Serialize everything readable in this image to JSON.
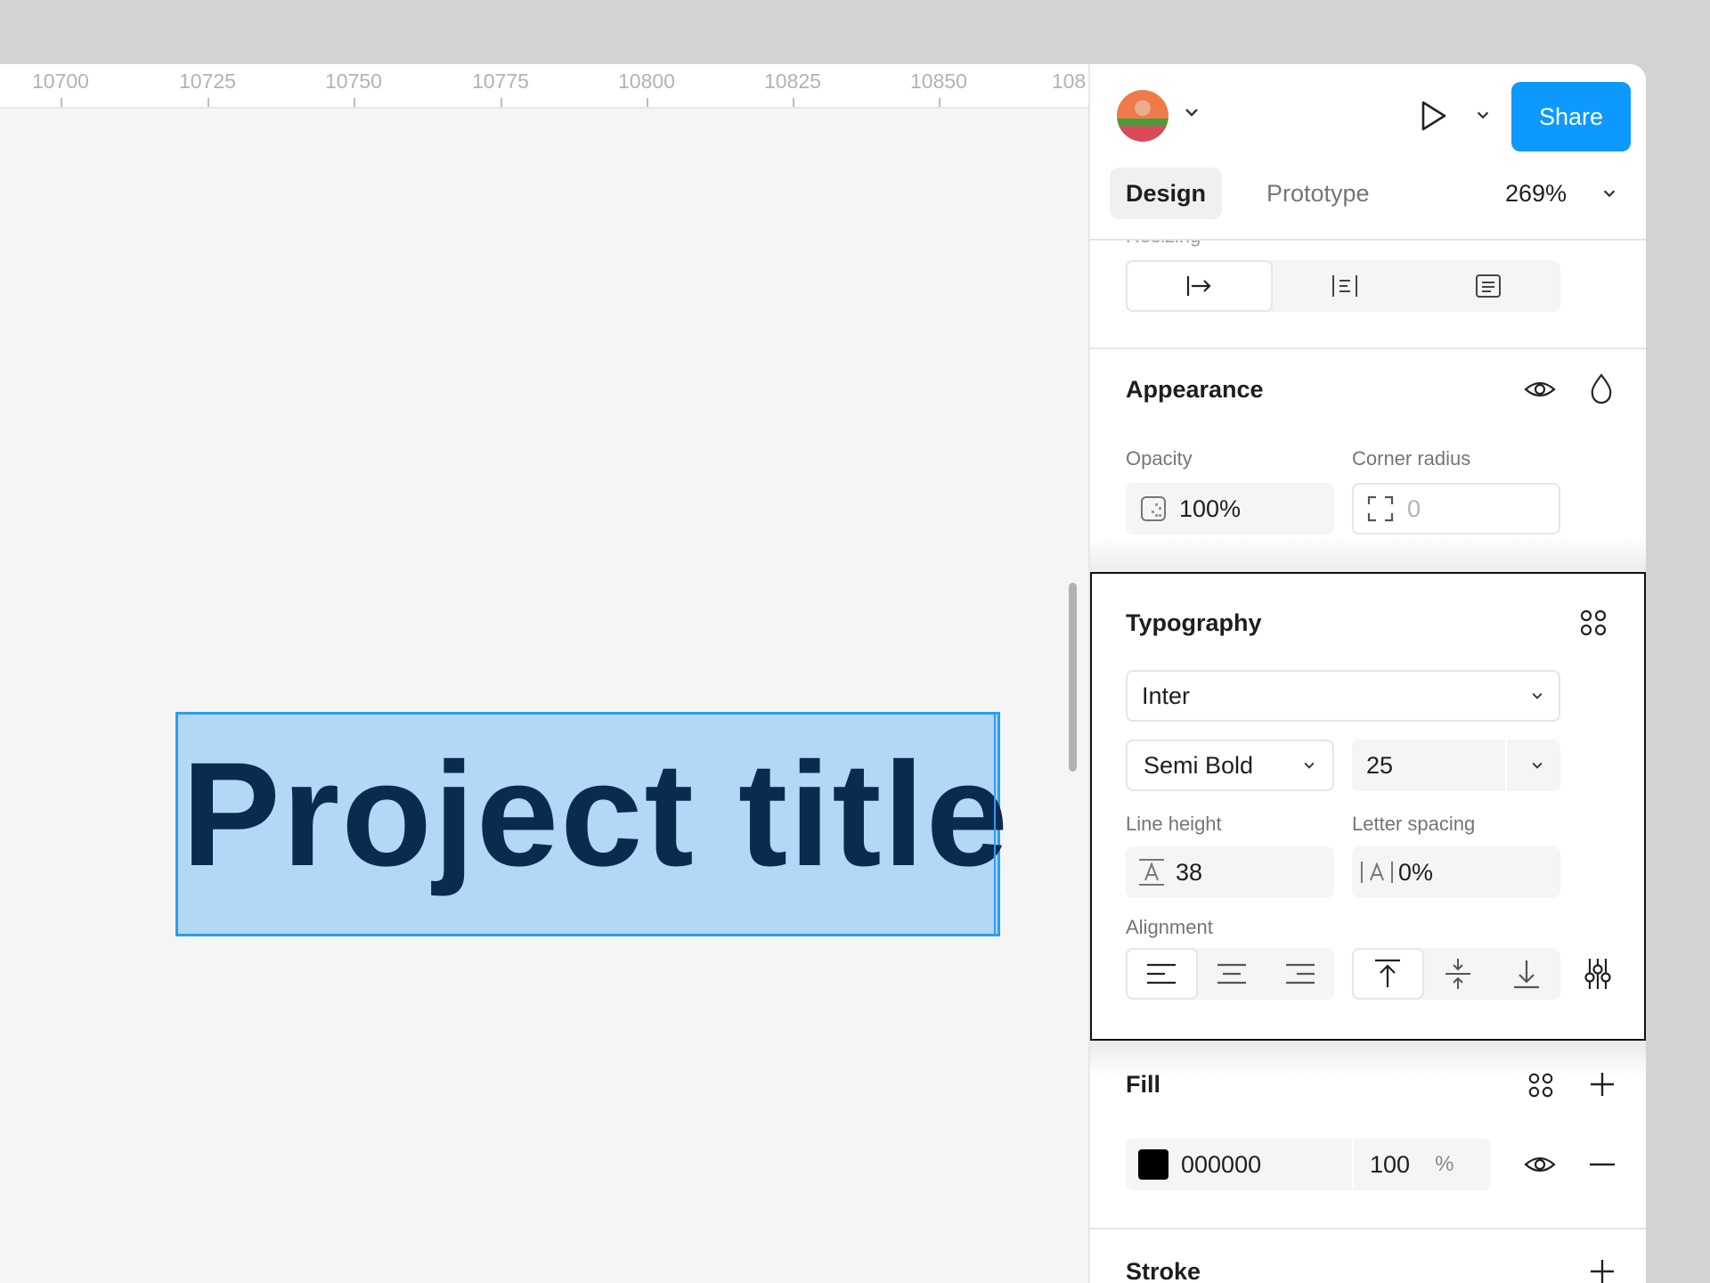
{
  "ruler": {
    "ticks": [
      "10700",
      "10725",
      "10750",
      "10775",
      "10800",
      "10825",
      "10850",
      "108"
    ]
  },
  "canvas": {
    "text_layer": "Project title"
  },
  "header": {
    "share_label": "Share",
    "zoom_value": "269%"
  },
  "tabs": [
    {
      "label": "Design",
      "active": true
    },
    {
      "label": "Prototype",
      "active": false
    }
  ],
  "resizing": {
    "title": "Resizing",
    "options": [
      "auto-width-icon",
      "auto-height-icon",
      "fixed-size-icon"
    ]
  },
  "appearance": {
    "title": "Appearance",
    "opacity_label": "Opacity",
    "opacity_value": "100%",
    "corner_radius_label": "Corner radius",
    "corner_radius_value": "0"
  },
  "typography": {
    "title": "Typography",
    "font_family": "Inter",
    "font_weight": "Semi Bold",
    "font_size": "25",
    "line_height_label": "Line height",
    "line_height_value": "38",
    "letter_spacing_label": "Letter spacing",
    "letter_spacing_value": "0%",
    "alignment_label": "Alignment"
  },
  "fill": {
    "title": "Fill",
    "hex": "000000",
    "opacity": "100",
    "percent_sign": "%"
  },
  "stroke": {
    "title": "Stroke"
  },
  "colors": {
    "accent": "#0d99ff",
    "selection": "#b3d7f6",
    "text_layer": "#0a2a4e",
    "swatch": "#000000"
  }
}
